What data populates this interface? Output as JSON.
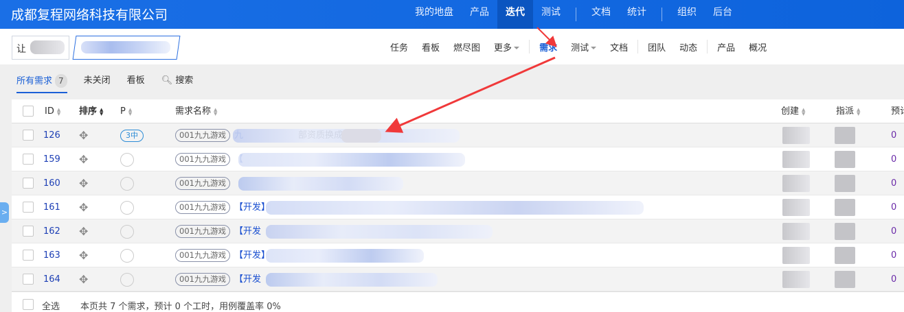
{
  "brand": "成都复程网络科技有限公司",
  "main_nav": [
    {
      "label": "我的地盘"
    },
    {
      "label": "产品"
    },
    {
      "label": "迭代",
      "active": true
    },
    {
      "label": "测试"
    },
    {
      "label": "文档"
    },
    {
      "label": "统计"
    },
    {
      "label": "组织"
    },
    {
      "label": "后台"
    }
  ],
  "breadcrumb": {
    "first_visible": "让"
  },
  "sub_nav": [
    {
      "label": "任务"
    },
    {
      "label": "看板"
    },
    {
      "label": "燃尽图"
    },
    {
      "label": "更多",
      "dropdown": true
    },
    {
      "label": "需求",
      "active": true
    },
    {
      "label": "测试",
      "dropdown": true
    },
    {
      "label": "文档"
    },
    {
      "label": "团队"
    },
    {
      "label": "动态"
    },
    {
      "label": "产品"
    },
    {
      "label": "概况"
    }
  ],
  "tabs": {
    "all": "所有需求",
    "all_count": "7",
    "unclosed": "未关闭",
    "kanban": "看板",
    "search": "搜索"
  },
  "table": {
    "headers": {
      "id": "ID",
      "order": "排序",
      "pri": "P",
      "name": "需求名称",
      "creator": "创建",
      "assignee": "指派",
      "estimate": "预计"
    },
    "rows": [
      {
        "id": "126",
        "pri": "3中",
        "product": "001九九游戏",
        "name_prefix": "九",
        "name_mid": "部资质换成",
        "estimate": "0"
      },
      {
        "id": "159",
        "pri": "",
        "product": "001九九游戏",
        "name_prefix": "【",
        "name_mid": "",
        "estimate": "0"
      },
      {
        "id": "160",
        "pri": "",
        "product": "001九九游戏",
        "name_prefix": "",
        "name_mid": "",
        "estimate": "0"
      },
      {
        "id": "161",
        "pri": "",
        "product": "001九九游戏",
        "name_prefix": "【开发】",
        "name_mid": "",
        "estimate": "0"
      },
      {
        "id": "162",
        "pri": "",
        "product": "001九九游戏",
        "name_prefix": "【开发",
        "name_mid": "",
        "estimate": "0"
      },
      {
        "id": "163",
        "pri": "",
        "product": "001九九游戏",
        "name_prefix": "【开发】",
        "name_mid": "",
        "estimate": "0"
      },
      {
        "id": "164",
        "pri": "",
        "product": "001九九游戏",
        "name_prefix": "【开发",
        "name_mid": "",
        "estimate": "0"
      }
    ]
  },
  "footer": {
    "select_all": "全选",
    "summary": "本页共 7 个需求，预计 0 个工时，用例覆盖率 0%"
  },
  "colors": {
    "brand": "#0d63dc",
    "accent": "#1a5fd6",
    "annotation_arrow": "#f0393a"
  }
}
